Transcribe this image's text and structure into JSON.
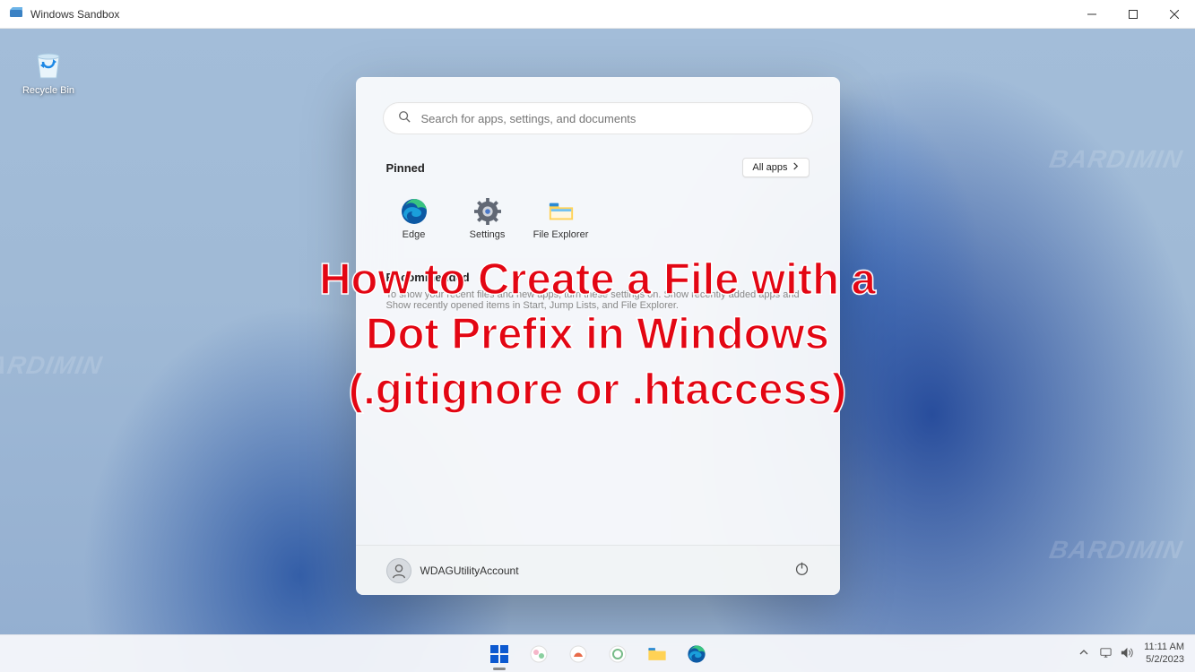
{
  "window": {
    "title": "Windows Sandbox"
  },
  "desktop": {
    "recycle_bin_label": "Recycle Bin"
  },
  "start_menu": {
    "search_placeholder": "Search for apps, settings, and documents",
    "pinned_label": "Pinned",
    "all_apps_label": "All apps",
    "tiles": [
      {
        "label": "Edge"
      },
      {
        "label": "Settings"
      },
      {
        "label": "File Explorer"
      }
    ],
    "recommended_label": "Recommended",
    "recommended_subtext": "To show your recent files and new apps, turn these settings on. Show recently added apps and Show recently opened items in Start, Jump Lists, and File Explorer.",
    "user_label": "WDAGUtilityAccount"
  },
  "headline": {
    "line1": "How to Create a File with a",
    "line2": "Dot Prefix in Windows",
    "line3": "(.gitignore or .htaccess)"
  },
  "systray": {
    "time": "11:11 AM",
    "date": "5/2/2023"
  },
  "watermark": "BARDIMIN"
}
